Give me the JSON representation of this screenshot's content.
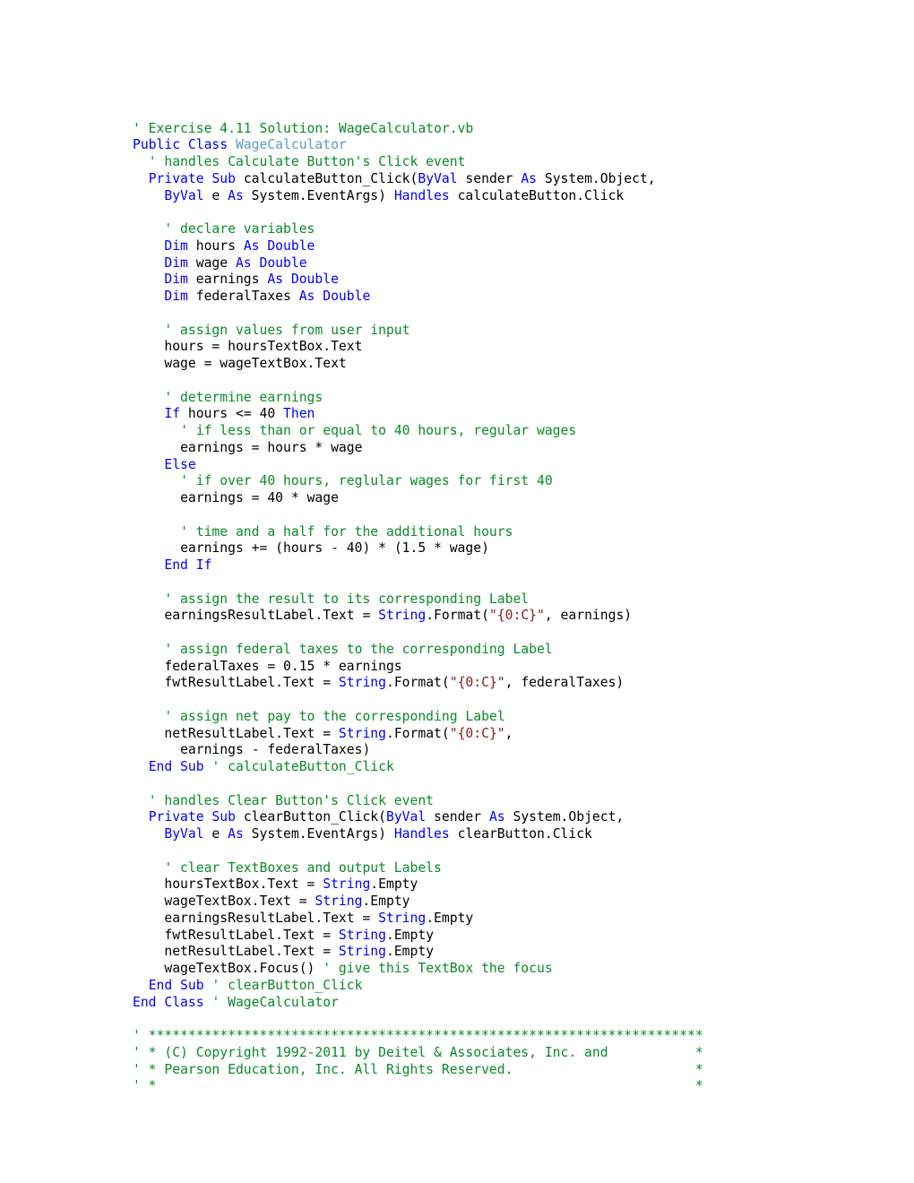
{
  "document": {
    "title": "WageCalculator.vb",
    "language": "Visual Basic",
    "exercise": "Exercise 4.11 Solution"
  },
  "colors": {
    "background": "#ffffff",
    "plain": "#000000",
    "comment": "#0a8a28",
    "keyword": "#0000ff",
    "type_name": "#5a9bc8",
    "string_literal": "#8b1a1a"
  },
  "code_lines": [
    {
      "indent": 0,
      "tokens": [
        {
          "t": "comment",
          "s": "' Exercise 4.11 Solution: WageCalculator.vb"
        }
      ]
    },
    {
      "indent": 0,
      "tokens": [
        {
          "t": "kw",
          "s": "Public Class "
        },
        {
          "t": "type",
          "s": "WageCalculator"
        }
      ]
    },
    {
      "indent": 1,
      "tokens": [
        {
          "t": "comment",
          "s": "' handles Calculate Button's Click event"
        }
      ]
    },
    {
      "indent": 1,
      "tokens": [
        {
          "t": "kw",
          "s": "Private Sub "
        },
        {
          "t": "plain",
          "s": "calculateButton_Click("
        },
        {
          "t": "kw",
          "s": "ByVal"
        },
        {
          "t": "plain",
          "s": " sender "
        },
        {
          "t": "kw",
          "s": "As"
        },
        {
          "t": "plain",
          "s": " System.Object,"
        }
      ]
    },
    {
      "indent": 2,
      "tokens": [
        {
          "t": "kw",
          "s": "ByVal"
        },
        {
          "t": "plain",
          "s": " e "
        },
        {
          "t": "kw",
          "s": "As"
        },
        {
          "t": "plain",
          "s": " System.EventArgs) "
        },
        {
          "t": "kw",
          "s": "Handles"
        },
        {
          "t": "plain",
          "s": " calculateButton.Click"
        }
      ]
    },
    {
      "indent": 0,
      "tokens": []
    },
    {
      "indent": 2,
      "tokens": [
        {
          "t": "comment",
          "s": "' declare variables"
        }
      ]
    },
    {
      "indent": 2,
      "tokens": [
        {
          "t": "kw",
          "s": "Dim"
        },
        {
          "t": "plain",
          "s": " hours "
        },
        {
          "t": "kw",
          "s": "As Double"
        }
      ]
    },
    {
      "indent": 2,
      "tokens": [
        {
          "t": "kw",
          "s": "Dim"
        },
        {
          "t": "plain",
          "s": " wage "
        },
        {
          "t": "kw",
          "s": "As Double"
        }
      ]
    },
    {
      "indent": 2,
      "tokens": [
        {
          "t": "kw",
          "s": "Dim"
        },
        {
          "t": "plain",
          "s": " earnings "
        },
        {
          "t": "kw",
          "s": "As Double"
        }
      ]
    },
    {
      "indent": 2,
      "tokens": [
        {
          "t": "kw",
          "s": "Dim"
        },
        {
          "t": "plain",
          "s": " federalTaxes "
        },
        {
          "t": "kw",
          "s": "As Double"
        }
      ]
    },
    {
      "indent": 0,
      "tokens": []
    },
    {
      "indent": 2,
      "tokens": [
        {
          "t": "comment",
          "s": "' assign values from user input"
        }
      ]
    },
    {
      "indent": 2,
      "tokens": [
        {
          "t": "plain",
          "s": "hours = hoursTextBox.Text"
        }
      ]
    },
    {
      "indent": 2,
      "tokens": [
        {
          "t": "plain",
          "s": "wage = wageTextBox.Text"
        }
      ]
    },
    {
      "indent": 0,
      "tokens": []
    },
    {
      "indent": 2,
      "tokens": [
        {
          "t": "comment",
          "s": "' determine earnings"
        }
      ]
    },
    {
      "indent": 2,
      "tokens": [
        {
          "t": "kw",
          "s": "If"
        },
        {
          "t": "plain",
          "s": " hours <= 40 "
        },
        {
          "t": "kw",
          "s": "Then"
        }
      ]
    },
    {
      "indent": 3,
      "tokens": [
        {
          "t": "comment",
          "s": "' if less than or equal to 40 hours, regular wages"
        }
      ]
    },
    {
      "indent": 3,
      "tokens": [
        {
          "t": "plain",
          "s": "earnings = hours * wage"
        }
      ]
    },
    {
      "indent": 2,
      "tokens": [
        {
          "t": "kw",
          "s": "Else"
        }
      ]
    },
    {
      "indent": 3,
      "tokens": [
        {
          "t": "comment",
          "s": "' if over 40 hours, reglular wages for first 40"
        }
      ]
    },
    {
      "indent": 3,
      "tokens": [
        {
          "t": "plain",
          "s": "earnings = 40 * wage"
        }
      ]
    },
    {
      "indent": 0,
      "tokens": []
    },
    {
      "indent": 3,
      "tokens": [
        {
          "t": "comment",
          "s": "' time and a half for the additional hours"
        }
      ]
    },
    {
      "indent": 3,
      "tokens": [
        {
          "t": "plain",
          "s": "earnings += (hours - 40) * (1.5 * wage)"
        }
      ]
    },
    {
      "indent": 2,
      "tokens": [
        {
          "t": "kw",
          "s": "End If"
        }
      ]
    },
    {
      "indent": 0,
      "tokens": []
    },
    {
      "indent": 2,
      "tokens": [
        {
          "t": "comment",
          "s": "' assign the result to its corresponding Label"
        }
      ]
    },
    {
      "indent": 2,
      "tokens": [
        {
          "t": "plain",
          "s": "earningsResultLabel.Text = "
        },
        {
          "t": "kw",
          "s": "String"
        },
        {
          "t": "plain",
          "s": ".Format("
        },
        {
          "t": "str",
          "s": "\"{0:C}\""
        },
        {
          "t": "plain",
          "s": ", earnings)"
        }
      ]
    },
    {
      "indent": 0,
      "tokens": []
    },
    {
      "indent": 2,
      "tokens": [
        {
          "t": "comment",
          "s": "' assign federal taxes to the corresponding Label"
        }
      ]
    },
    {
      "indent": 2,
      "tokens": [
        {
          "t": "plain",
          "s": "federalTaxes = 0.15 * earnings"
        }
      ]
    },
    {
      "indent": 2,
      "tokens": [
        {
          "t": "plain",
          "s": "fwtResultLabel.Text = "
        },
        {
          "t": "kw",
          "s": "String"
        },
        {
          "t": "plain",
          "s": ".Format("
        },
        {
          "t": "str",
          "s": "\"{0:C}\""
        },
        {
          "t": "plain",
          "s": ", federalTaxes)"
        }
      ]
    },
    {
      "indent": 0,
      "tokens": []
    },
    {
      "indent": 2,
      "tokens": [
        {
          "t": "comment",
          "s": "' assign net pay to the corresponding Label"
        }
      ]
    },
    {
      "indent": 2,
      "tokens": [
        {
          "t": "plain",
          "s": "netResultLabel.Text = "
        },
        {
          "t": "kw",
          "s": "String"
        },
        {
          "t": "plain",
          "s": ".Format("
        },
        {
          "t": "str",
          "s": "\"{0:C}\""
        },
        {
          "t": "plain",
          "s": ","
        }
      ]
    },
    {
      "indent": 3,
      "tokens": [
        {
          "t": "plain",
          "s": "earnings - federalTaxes)"
        }
      ]
    },
    {
      "indent": 1,
      "tokens": [
        {
          "t": "kw",
          "s": "End Sub "
        },
        {
          "t": "comment",
          "s": "' calculateButton_Click"
        }
      ]
    },
    {
      "indent": 0,
      "tokens": []
    },
    {
      "indent": 1,
      "tokens": [
        {
          "t": "comment",
          "s": "' handles Clear Button's Click event"
        }
      ]
    },
    {
      "indent": 1,
      "tokens": [
        {
          "t": "kw",
          "s": "Private Sub "
        },
        {
          "t": "plain",
          "s": "clearButton_Click("
        },
        {
          "t": "kw",
          "s": "ByVal"
        },
        {
          "t": "plain",
          "s": " sender "
        },
        {
          "t": "kw",
          "s": "As"
        },
        {
          "t": "plain",
          "s": " System.Object,"
        }
      ]
    },
    {
      "indent": 2,
      "tokens": [
        {
          "t": "kw",
          "s": "ByVal"
        },
        {
          "t": "plain",
          "s": " e "
        },
        {
          "t": "kw",
          "s": "As"
        },
        {
          "t": "plain",
          "s": " System.EventArgs) "
        },
        {
          "t": "kw",
          "s": "Handles"
        },
        {
          "t": "plain",
          "s": " clearButton.Click"
        }
      ]
    },
    {
      "indent": 0,
      "tokens": []
    },
    {
      "indent": 2,
      "tokens": [
        {
          "t": "comment",
          "s": "' clear TextBoxes and output Labels"
        }
      ]
    },
    {
      "indent": 2,
      "tokens": [
        {
          "t": "plain",
          "s": "hoursTextBox.Text = "
        },
        {
          "t": "kw",
          "s": "String"
        },
        {
          "t": "plain",
          "s": ".Empty"
        }
      ]
    },
    {
      "indent": 2,
      "tokens": [
        {
          "t": "plain",
          "s": "wageTextBox.Text = "
        },
        {
          "t": "kw",
          "s": "String"
        },
        {
          "t": "plain",
          "s": ".Empty"
        }
      ]
    },
    {
      "indent": 2,
      "tokens": [
        {
          "t": "plain",
          "s": "earningsResultLabel.Text = "
        },
        {
          "t": "kw",
          "s": "String"
        },
        {
          "t": "plain",
          "s": ".Empty"
        }
      ]
    },
    {
      "indent": 2,
      "tokens": [
        {
          "t": "plain",
          "s": "fwtResultLabel.Text = "
        },
        {
          "t": "kw",
          "s": "String"
        },
        {
          "t": "plain",
          "s": ".Empty"
        }
      ]
    },
    {
      "indent": 2,
      "tokens": [
        {
          "t": "plain",
          "s": "netResultLabel.Text = "
        },
        {
          "t": "kw",
          "s": "String"
        },
        {
          "t": "plain",
          "s": ".Empty"
        }
      ]
    },
    {
      "indent": 2,
      "tokens": [
        {
          "t": "plain",
          "s": "wageTextBox.Focus() "
        },
        {
          "t": "comment",
          "s": "' give this TextBox the focus"
        }
      ]
    },
    {
      "indent": 1,
      "tokens": [
        {
          "t": "kw",
          "s": "End Sub "
        },
        {
          "t": "comment",
          "s": "' clearButton_Click"
        }
      ]
    },
    {
      "indent": 0,
      "tokens": [
        {
          "t": "kw",
          "s": "End Class "
        },
        {
          "t": "comment",
          "s": "' WageCalculator"
        }
      ]
    },
    {
      "indent": 0,
      "tokens": []
    },
    {
      "indent": 0,
      "tokens": [
        {
          "t": "comment",
          "s": "' **********************************************************************"
        }
      ]
    },
    {
      "indent": 0,
      "tokens": [
        {
          "t": "comment",
          "s": "' * (C) Copyright 1992-2011 by Deitel & Associates, Inc. and           *"
        }
      ]
    },
    {
      "indent": 0,
      "tokens": [
        {
          "t": "comment",
          "s": "' * Pearson Education, Inc. All Rights Reserved.                       *"
        }
      ]
    },
    {
      "indent": 0,
      "tokens": [
        {
          "t": "comment",
          "s": "' *                                                                    *"
        }
      ]
    }
  ]
}
